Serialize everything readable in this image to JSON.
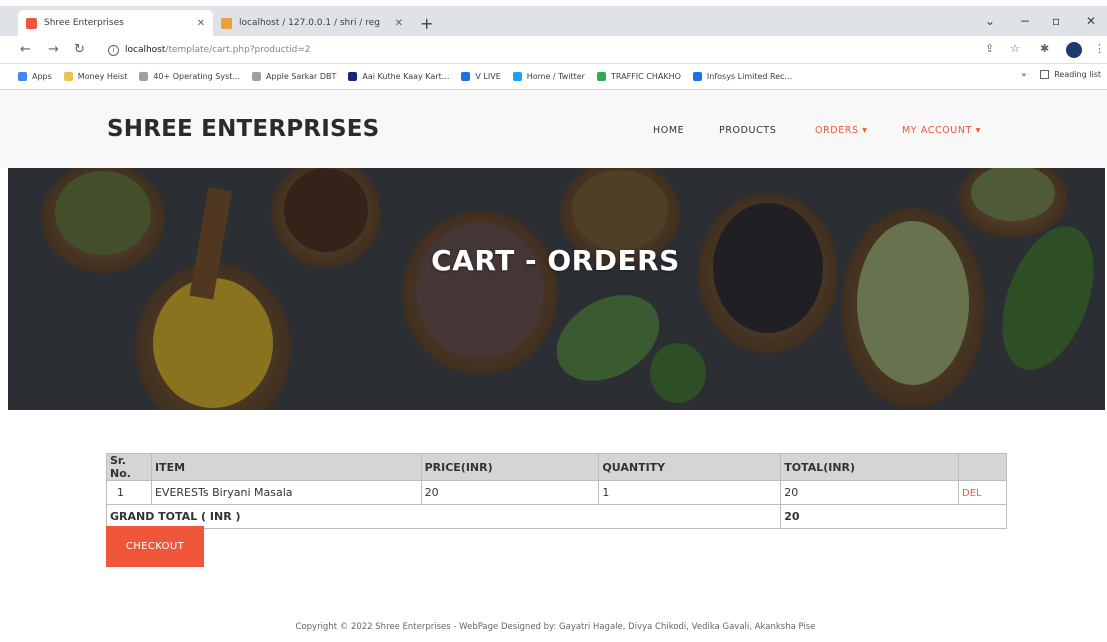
{
  "browser": {
    "tabs": [
      {
        "title": "Shree Enterprises",
        "active": true,
        "color": "#f0573a"
      },
      {
        "title": "localhost / 127.0.0.1 / shri / reg",
        "active": false,
        "color": "#e8a33d"
      }
    ],
    "url_host": "localhost",
    "url_path": "/template/cart.php?productid=2",
    "bookmarks": [
      {
        "label": "Apps",
        "color": "#4285f4"
      },
      {
        "label": "Money Heist",
        "color": "#e8c34d"
      },
      {
        "label": "40+ Operating Syst...",
        "color": "#9aa0a6"
      },
      {
        "label": "Apple Sarkar DBT",
        "color": "#9aa0a6"
      },
      {
        "label": "Aai Kuthe Kaay Kart...",
        "color": "#1a237e"
      },
      {
        "label": "V LIVE",
        "color": "#1a73e8"
      },
      {
        "label": "Home / Twitter",
        "color": "#1da1f2"
      },
      {
        "label": "TRAFFIC CHAKHO",
        "color": "#34a853"
      },
      {
        "label": "Infosys Limited Rec...",
        "color": "#1a73e8"
      }
    ],
    "reading_list": "Reading list"
  },
  "site": {
    "brand": "SHREE ENTERPRISES",
    "nav": {
      "home": "HOME",
      "products": "PRODUCTS",
      "orders": "ORDERS ▾",
      "account": "MY ACCOUNT ▾"
    },
    "hero_title": "CART - ORDERS"
  },
  "cart": {
    "headers": [
      "Sr. No.",
      "ITEM",
      "PRICE(INR)",
      "QUANTITY",
      "TOTAL(INR)",
      ""
    ],
    "rows": [
      {
        "sr": "1",
        "item": "EVERESTs Biryani Masala",
        "price": "20",
        "qty": "1",
        "total": "20",
        "action": "DEL"
      }
    ],
    "grand_total_label": "GRAND TOTAL ( INR )",
    "grand_total": "20",
    "checkout_label": "CHECKOUT"
  },
  "footer": "Copyright © 2022 Shree Enterprises - WebPage Designed by: Gayatri Hagale, Divya Chikodi, Vedika Gavali, Akanksha Pise",
  "colors": {
    "accent": "#f0573a",
    "header_bg": "#f8f8f8",
    "table_header": "#d5d5d5"
  }
}
